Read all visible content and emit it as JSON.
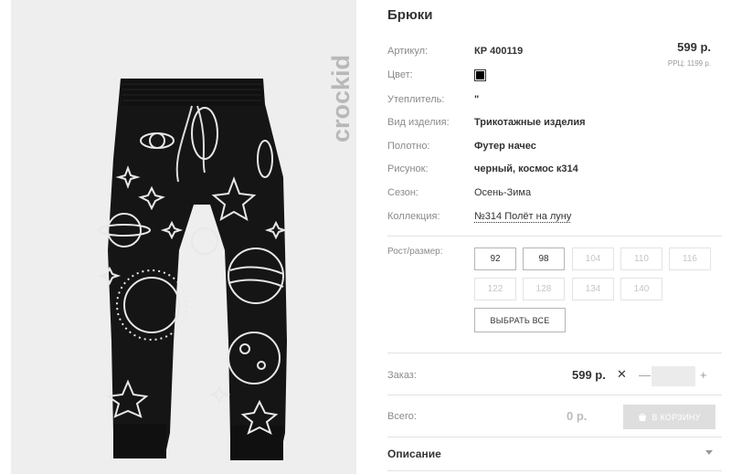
{
  "brand": {
    "logo_text": "crockid"
  },
  "product": {
    "title": "Брюки",
    "price": "599 р.",
    "rrc": "РРЦ: 1199 р."
  },
  "attributes": [
    {
      "label": "Артикул:",
      "value": "КР 400119"
    },
    {
      "label": "Цвет:",
      "value": "",
      "swatch_color": "#000000"
    },
    {
      "label": "Утеплитель:",
      "value": "\""
    },
    {
      "label": "Вид изделия:",
      "value": "Трикотажные изделия"
    },
    {
      "label": "Полотно:",
      "value": "Футер начес"
    },
    {
      "label": "Рисунок:",
      "value": "черный, космос к314"
    },
    {
      "label": "Сезон:",
      "value": "Осень-Зима"
    },
    {
      "label": "Коллекция:",
      "value": "№314 Полёт на луну"
    }
  ],
  "sizes": {
    "label": "Рост/размер:",
    "items": [
      {
        "label": "92",
        "available": true
      },
      {
        "label": "98",
        "available": true
      },
      {
        "label": "104",
        "available": false
      },
      {
        "label": "110",
        "available": false
      },
      {
        "label": "116",
        "available": false
      },
      {
        "label": "122",
        "available": false
      },
      {
        "label": "128",
        "available": false
      },
      {
        "label": "134",
        "available": false
      },
      {
        "label": "140",
        "available": false
      }
    ],
    "select_all_label": "ВЫБРАТЬ ВСЕ"
  },
  "order": {
    "label": "Заказ:",
    "price": "599 р.",
    "times": "✕",
    "minus": "—",
    "plus": "+",
    "qty_value": ""
  },
  "total": {
    "label": "Всего:",
    "value": "0 р.",
    "cart_label": "В КОРЗИНУ"
  },
  "description": {
    "label": "Описание"
  },
  "colors": {
    "accent": "#333333",
    "muted": "#8a8a8a",
    "disabled": "#c6c6c6",
    "panel_bg": "#eeeeee"
  },
  "icons": [
    "crockid-logo",
    "cart-icon",
    "chevron-down-icon"
  ]
}
